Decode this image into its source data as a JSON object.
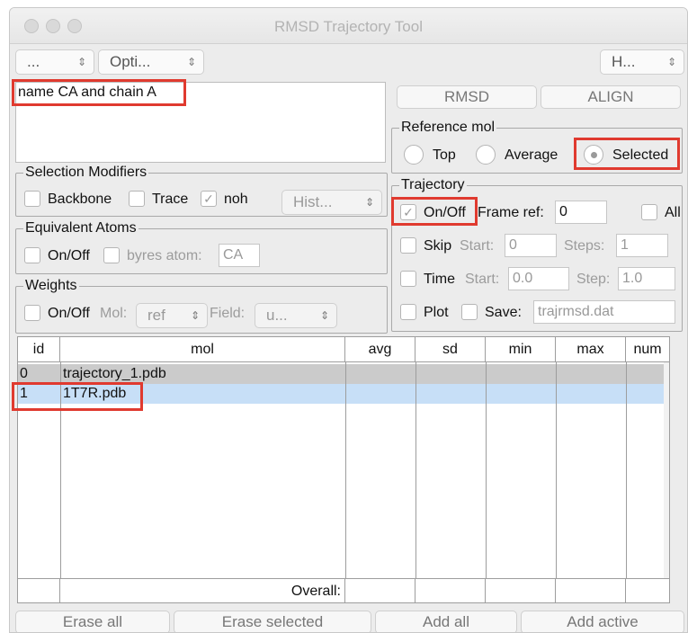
{
  "window": {
    "title": "RMSD Trajectory Tool"
  },
  "menubar": {
    "file_label": "...",
    "options_label": "Opti...",
    "help_label": "H..."
  },
  "selection": {
    "text": "name CA and chain A"
  },
  "actions": {
    "rmsd_label": "RMSD",
    "align_label": "ALIGN"
  },
  "reference_mol": {
    "legend": "Reference mol",
    "options": [
      "Top",
      "Average",
      "Selected"
    ],
    "selected": "Selected"
  },
  "selection_modifiers": {
    "legend": "Selection Modifiers",
    "backbone_label": "Backbone",
    "trace_label": "Trace",
    "noh_label": "noh",
    "noh_checked": true,
    "history_label": "Hist..."
  },
  "equivalent_atoms": {
    "legend": "Equivalent Atoms",
    "onoff_label": "On/Off",
    "byres_label": "byres atom:",
    "atom_value": "CA"
  },
  "weights": {
    "legend": "Weights",
    "onoff_label": "On/Off",
    "mol_label": "Mol:",
    "mol_value": "ref",
    "field_label": "Field:",
    "field_value": "u..."
  },
  "trajectory": {
    "legend": "Trajectory",
    "onoff_label": "On/Off",
    "onoff_checked": true,
    "frame_ref_label": "Frame ref:",
    "frame_ref_value": "0",
    "all_label": "All",
    "skip_label": "Skip",
    "start_label": "Start:",
    "skip_start_value": "0",
    "steps_label": "Steps:",
    "steps_value": "1",
    "time_label": "Time",
    "time_start_value": "0.0",
    "step_label": "Step:",
    "step_value": "1.0",
    "plot_label": "Plot",
    "save_label": "Save:",
    "save_value": "trajrmsd.dat"
  },
  "table": {
    "columns": [
      "id",
      "mol",
      "avg",
      "sd",
      "min",
      "max",
      "num"
    ],
    "rows": [
      {
        "id": "0",
        "mol": "trajectory_1.pdb"
      },
      {
        "id": "1",
        "mol": "1T7R.pdb"
      }
    ],
    "overall_label": "Overall:"
  },
  "bottom_buttons": {
    "erase_all": "Erase all",
    "erase_selected": "Erase selected",
    "add_all": "Add all",
    "add_active": "Add active"
  },
  "colors": {
    "highlight_red": "#e03a2f",
    "row_selected": "#c7dff7",
    "row_grey": "#cbcbcb"
  }
}
